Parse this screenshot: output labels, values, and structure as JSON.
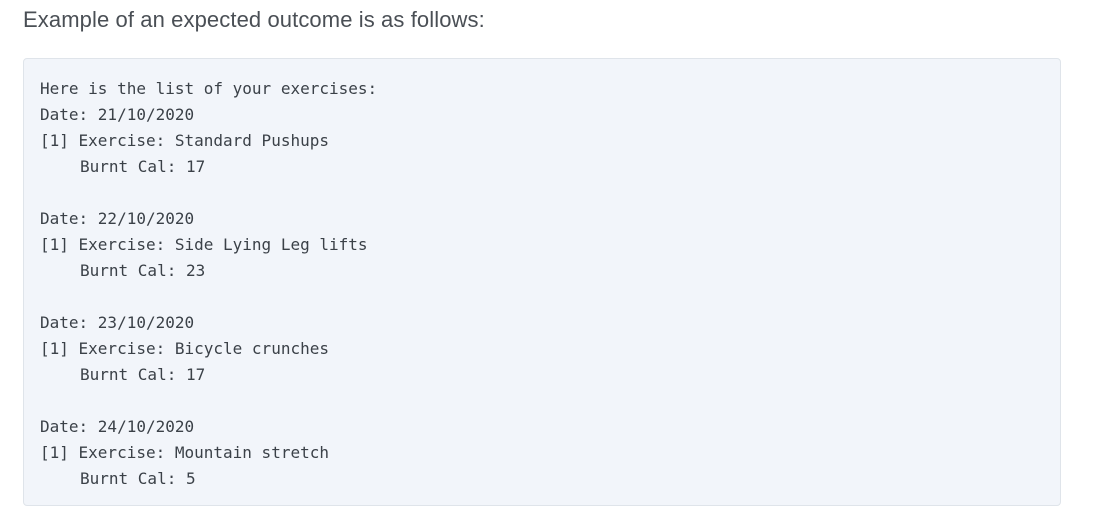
{
  "intro": "Example of an expected outcome is as follows:",
  "output": {
    "header": "Here is the list of your exercises:",
    "entries": [
      {
        "date": "Date: 21/10/2020",
        "exercise": "[1] Exercise: Standard Pushups",
        "cal": "Burnt Cal: 17"
      },
      {
        "date": "Date: 22/10/2020",
        "exercise": "[1] Exercise: Side Lying Leg lifts",
        "cal": "Burnt Cal: 23"
      },
      {
        "date": "Date: 23/10/2020",
        "exercise": "[1] Exercise: Bicycle crunches",
        "cal": "Burnt Cal: 17"
      },
      {
        "date": "Date: 24/10/2020",
        "exercise": "[1] Exercise: Mountain stretch",
        "cal": "Burnt Cal: 5"
      }
    ]
  }
}
